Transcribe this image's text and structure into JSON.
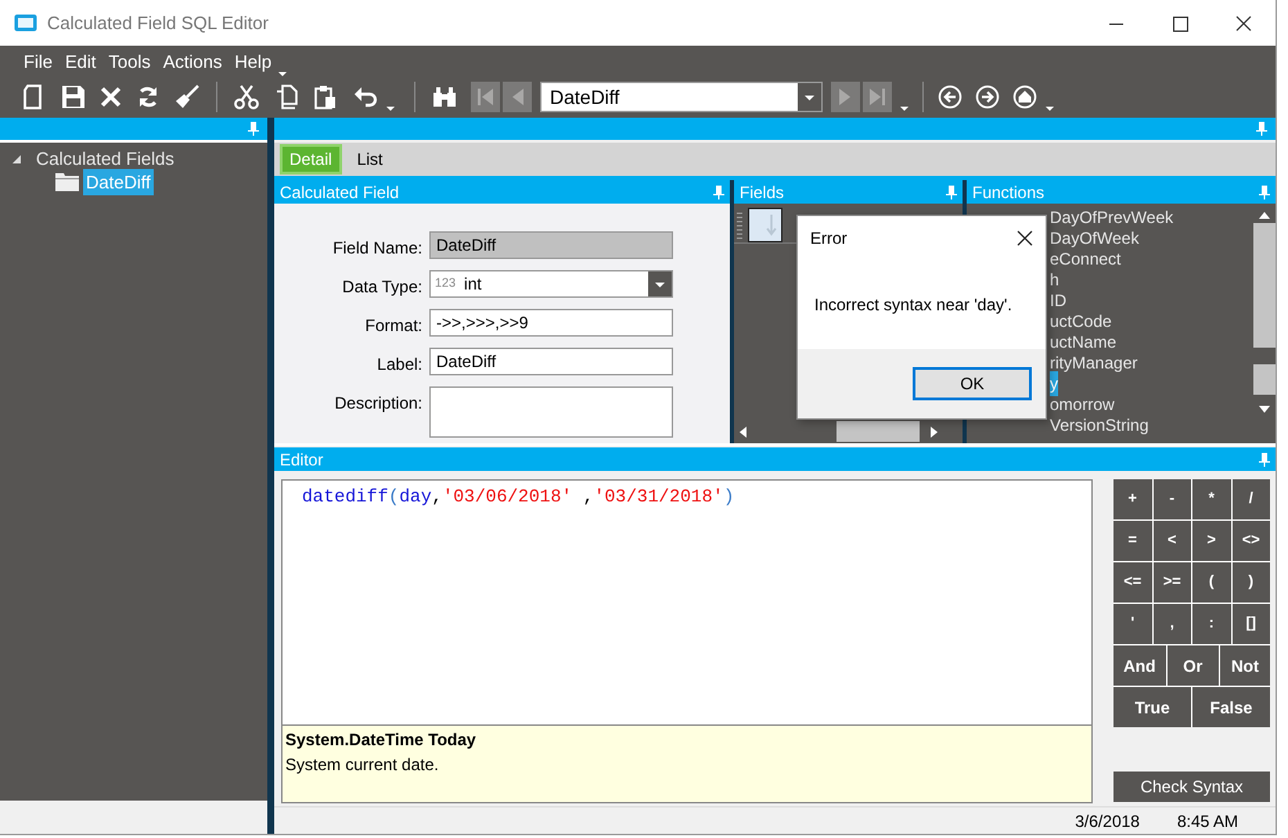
{
  "window": {
    "title": "Calculated Field SQL Editor"
  },
  "menu": [
    "File",
    "Edit",
    "Tools",
    "Actions",
    "Help"
  ],
  "toolbar": {
    "record_combo": "DateDiff"
  },
  "tree": [
    {
      "label": "Calculated Fields",
      "expanded": true,
      "selected": false,
      "children": [
        {
          "label": "DateDiff",
          "selected": true
        }
      ]
    }
  ],
  "tabs": [
    {
      "label": "Detail",
      "selected": true
    },
    {
      "label": "List",
      "selected": false
    }
  ],
  "calculated_field": {
    "title": "Calculated Field",
    "fields": [
      {
        "label": "Field Name:",
        "kind": "readonly",
        "value": "DateDiff"
      },
      {
        "label": "Data Type:",
        "kind": "combo",
        "prefix": "123",
        "value": "int"
      },
      {
        "label": "Format:",
        "kind": "text",
        "value": "->>,>>>,>>9"
      },
      {
        "label": "Label:",
        "kind": "text",
        "value": "DateDiff"
      },
      {
        "label": "Description:",
        "kind": "textarea"
      }
    ]
  },
  "fields_panel": {
    "title": "Fields"
  },
  "functions_panel": {
    "title": "Functions",
    "items": [
      {
        "label": "DayOfPrevWeek",
        "selected": false
      },
      {
        "label": "DayOfWeek",
        "selected": false
      },
      {
        "label": "eConnect",
        "selected": false
      },
      {
        "label": "h",
        "selected": false
      },
      {
        "label": "ID",
        "selected": false
      },
      {
        "label": "uctCode",
        "selected": false
      },
      {
        "label": "uctName",
        "selected": false
      },
      {
        "label": "rityManager",
        "selected": false
      },
      {
        "label": "y",
        "selected": true
      },
      {
        "label": "omorrow",
        "selected": false
      },
      {
        "label": "VersionString",
        "selected": false
      }
    ]
  },
  "editor": {
    "title": "Editor",
    "code": [
      {
        "text": "datediff",
        "kind": "function"
      },
      {
        "text": "(",
        "kind": "paren"
      },
      {
        "text": "day",
        "kind": "function"
      },
      {
        "text": ",",
        "kind": "punct"
      },
      {
        "text": "'03/06/2018'",
        "kind": "string"
      },
      {
        "text": " ,",
        "kind": "punct"
      },
      {
        "text": "'03/31/2018'",
        "kind": "string"
      },
      {
        "text": ")",
        "kind": "paren"
      }
    ],
    "help": {
      "signature": "System.DateTime Today",
      "description": "System current date."
    }
  },
  "operators": [
    [
      "+",
      "-",
      "*",
      "/"
    ],
    [
      "=",
      "<",
      ">",
      "<>"
    ],
    [
      "<=",
      ">=",
      "(",
      ")"
    ],
    [
      "'",
      ",",
      ":",
      "[]"
    ],
    [
      "And",
      "Or",
      "Not"
    ],
    [
      "True",
      "False"
    ]
  ],
  "check_syntax": "Check Syntax",
  "status_bar": {
    "date": "3/6/2018",
    "time": "8:45 AM"
  },
  "dialog": {
    "title": "Error",
    "message": "Incorrect syntax near 'day'.",
    "button": "OK"
  }
}
